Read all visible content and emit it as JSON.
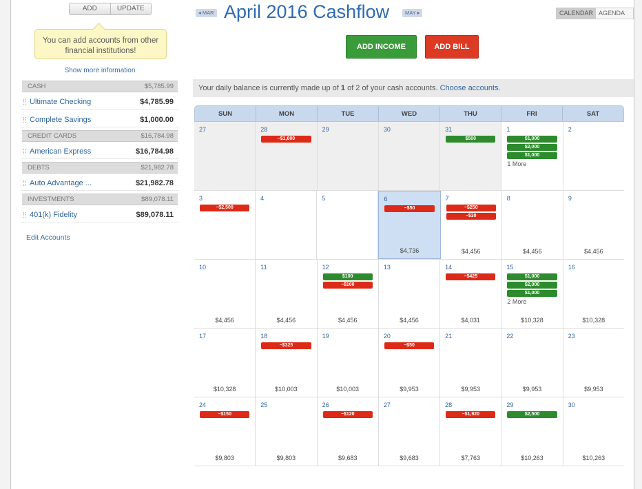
{
  "sidebar": {
    "add_label": "ADD",
    "update_label": "UPDATE",
    "promo_text": "You can add accounts from other financial institutions!",
    "show_more": "Show more information",
    "edit_accounts": "Edit Accounts",
    "groups": [
      {
        "name": "CASH",
        "total": "$5,785.99",
        "accounts": [
          {
            "name": "Ultimate Checking",
            "balance": "$4,785.99"
          },
          {
            "name": "Complete Savings",
            "balance": "$1,000.00"
          }
        ]
      },
      {
        "name": "CREDIT CARDS",
        "total": "$16,784.98",
        "accounts": [
          {
            "name": "American Express",
            "balance": "$16,784.98"
          }
        ]
      },
      {
        "name": "DEBTS",
        "total": "$21,982.78",
        "accounts": [
          {
            "name": "Auto Advantage ...",
            "balance": "$21,982.78"
          }
        ]
      },
      {
        "name": "INVESTMENTS",
        "total": "$89,078.11",
        "accounts": [
          {
            "name": "401(k) Fidelity",
            "balance": "$89,078.11"
          }
        ]
      }
    ]
  },
  "header": {
    "prev_month": "◂ MAR",
    "title": "April 2016 Cashflow",
    "next_month": "MAY ▸",
    "view_calendar": "CALENDAR",
    "view_agenda": "AGENDA"
  },
  "actions": {
    "add_income": "ADD INCOME",
    "add_bill": "ADD BILL"
  },
  "info": {
    "prefix": "Your daily balance is currently made up of ",
    "count": "1",
    "mid": " of 2 of your cash accounts. ",
    "link": "Choose accounts."
  },
  "calendar": {
    "days_of_week": [
      "SUN",
      "MON",
      "TUE",
      "WED",
      "THU",
      "FRI",
      "SAT"
    ],
    "weeks": [
      [
        {
          "d": "27",
          "past": true,
          "tx": [],
          "bal": ""
        },
        {
          "d": "28",
          "past": true,
          "tx": [
            {
              "t": "exp",
              "a": "−$1,600"
            }
          ],
          "bal": ""
        },
        {
          "d": "29",
          "past": true,
          "tx": [],
          "bal": ""
        },
        {
          "d": "30",
          "past": true,
          "tx": [],
          "bal": ""
        },
        {
          "d": "31",
          "past": true,
          "tx": [
            {
              "t": "inc",
              "a": "$500"
            }
          ],
          "bal": ""
        },
        {
          "d": "1",
          "tx": [
            {
              "t": "inc",
              "a": "$1,000"
            },
            {
              "t": "inc",
              "a": "$2,000"
            },
            {
              "t": "inc",
              "a": "$1,000"
            }
          ],
          "more": "1 More",
          "bal": ""
        },
        {
          "d": "2",
          "tx": [],
          "bal": ""
        }
      ],
      [
        {
          "d": "3",
          "tx": [
            {
              "t": "exp",
              "a": "−$2,500"
            }
          ],
          "bal": ""
        },
        {
          "d": "4",
          "tx": [],
          "bal": ""
        },
        {
          "d": "5",
          "tx": [],
          "bal": ""
        },
        {
          "d": "6",
          "today": true,
          "tx": [
            {
              "t": "exp",
              "a": "−$50"
            }
          ],
          "bal": "$4,736"
        },
        {
          "d": "7",
          "tx": [
            {
              "t": "exp",
              "a": "−$250"
            },
            {
              "t": "exp",
              "a": "−$30"
            }
          ],
          "bal": "$4,456"
        },
        {
          "d": "8",
          "tx": [],
          "bal": "$4,456"
        },
        {
          "d": "9",
          "tx": [],
          "bal": "$4,456"
        }
      ],
      [
        {
          "d": "10",
          "tx": [],
          "bal": "$4,456"
        },
        {
          "d": "11",
          "tx": [],
          "bal": "$4,456"
        },
        {
          "d": "12",
          "tx": [
            {
              "t": "inc",
              "a": "$100"
            },
            {
              "t": "exp",
              "a": "−$100"
            }
          ],
          "bal": "$4,456"
        },
        {
          "d": "13",
          "tx": [],
          "bal": "$4,456"
        },
        {
          "d": "14",
          "tx": [
            {
              "t": "exp",
              "a": "−$425"
            }
          ],
          "bal": "$4,031"
        },
        {
          "d": "15",
          "tx": [
            {
              "t": "inc",
              "a": "$1,000"
            },
            {
              "t": "inc",
              "a": "$2,000"
            },
            {
              "t": "inc",
              "a": "$1,000"
            }
          ],
          "more": "2 More",
          "bal": "$10,328"
        },
        {
          "d": "16",
          "tx": [],
          "bal": "$10,328"
        }
      ],
      [
        {
          "d": "17",
          "tx": [],
          "bal": "$10,328"
        },
        {
          "d": "18",
          "tx": [
            {
              "t": "exp",
              "a": "−$325"
            }
          ],
          "bal": "$10,003"
        },
        {
          "d": "19",
          "tx": [],
          "bal": "$10,003"
        },
        {
          "d": "20",
          "tx": [
            {
              "t": "exp",
              "a": "−$50"
            }
          ],
          "bal": "$9,953"
        },
        {
          "d": "21",
          "tx": [],
          "bal": "$9,953"
        },
        {
          "d": "22",
          "tx": [],
          "bal": "$9,953"
        },
        {
          "d": "23",
          "tx": [],
          "bal": "$9,953"
        }
      ],
      [
        {
          "d": "24",
          "tx": [
            {
              "t": "exp",
              "a": "−$150"
            }
          ],
          "bal": "$9,803"
        },
        {
          "d": "25",
          "tx": [],
          "bal": "$9,803"
        },
        {
          "d": "26",
          "tx": [
            {
              "t": "exp",
              "a": "−$120"
            }
          ],
          "bal": "$9,683"
        },
        {
          "d": "27",
          "tx": [],
          "bal": "$9,683"
        },
        {
          "d": "28",
          "tx": [
            {
              "t": "exp",
              "a": "−$1,920"
            }
          ],
          "bal": "$7,763"
        },
        {
          "d": "29",
          "tx": [
            {
              "t": "inc",
              "a": "$2,500"
            }
          ],
          "bal": "$10,263"
        },
        {
          "d": "30",
          "tx": [],
          "bal": "$10,263"
        }
      ]
    ]
  }
}
